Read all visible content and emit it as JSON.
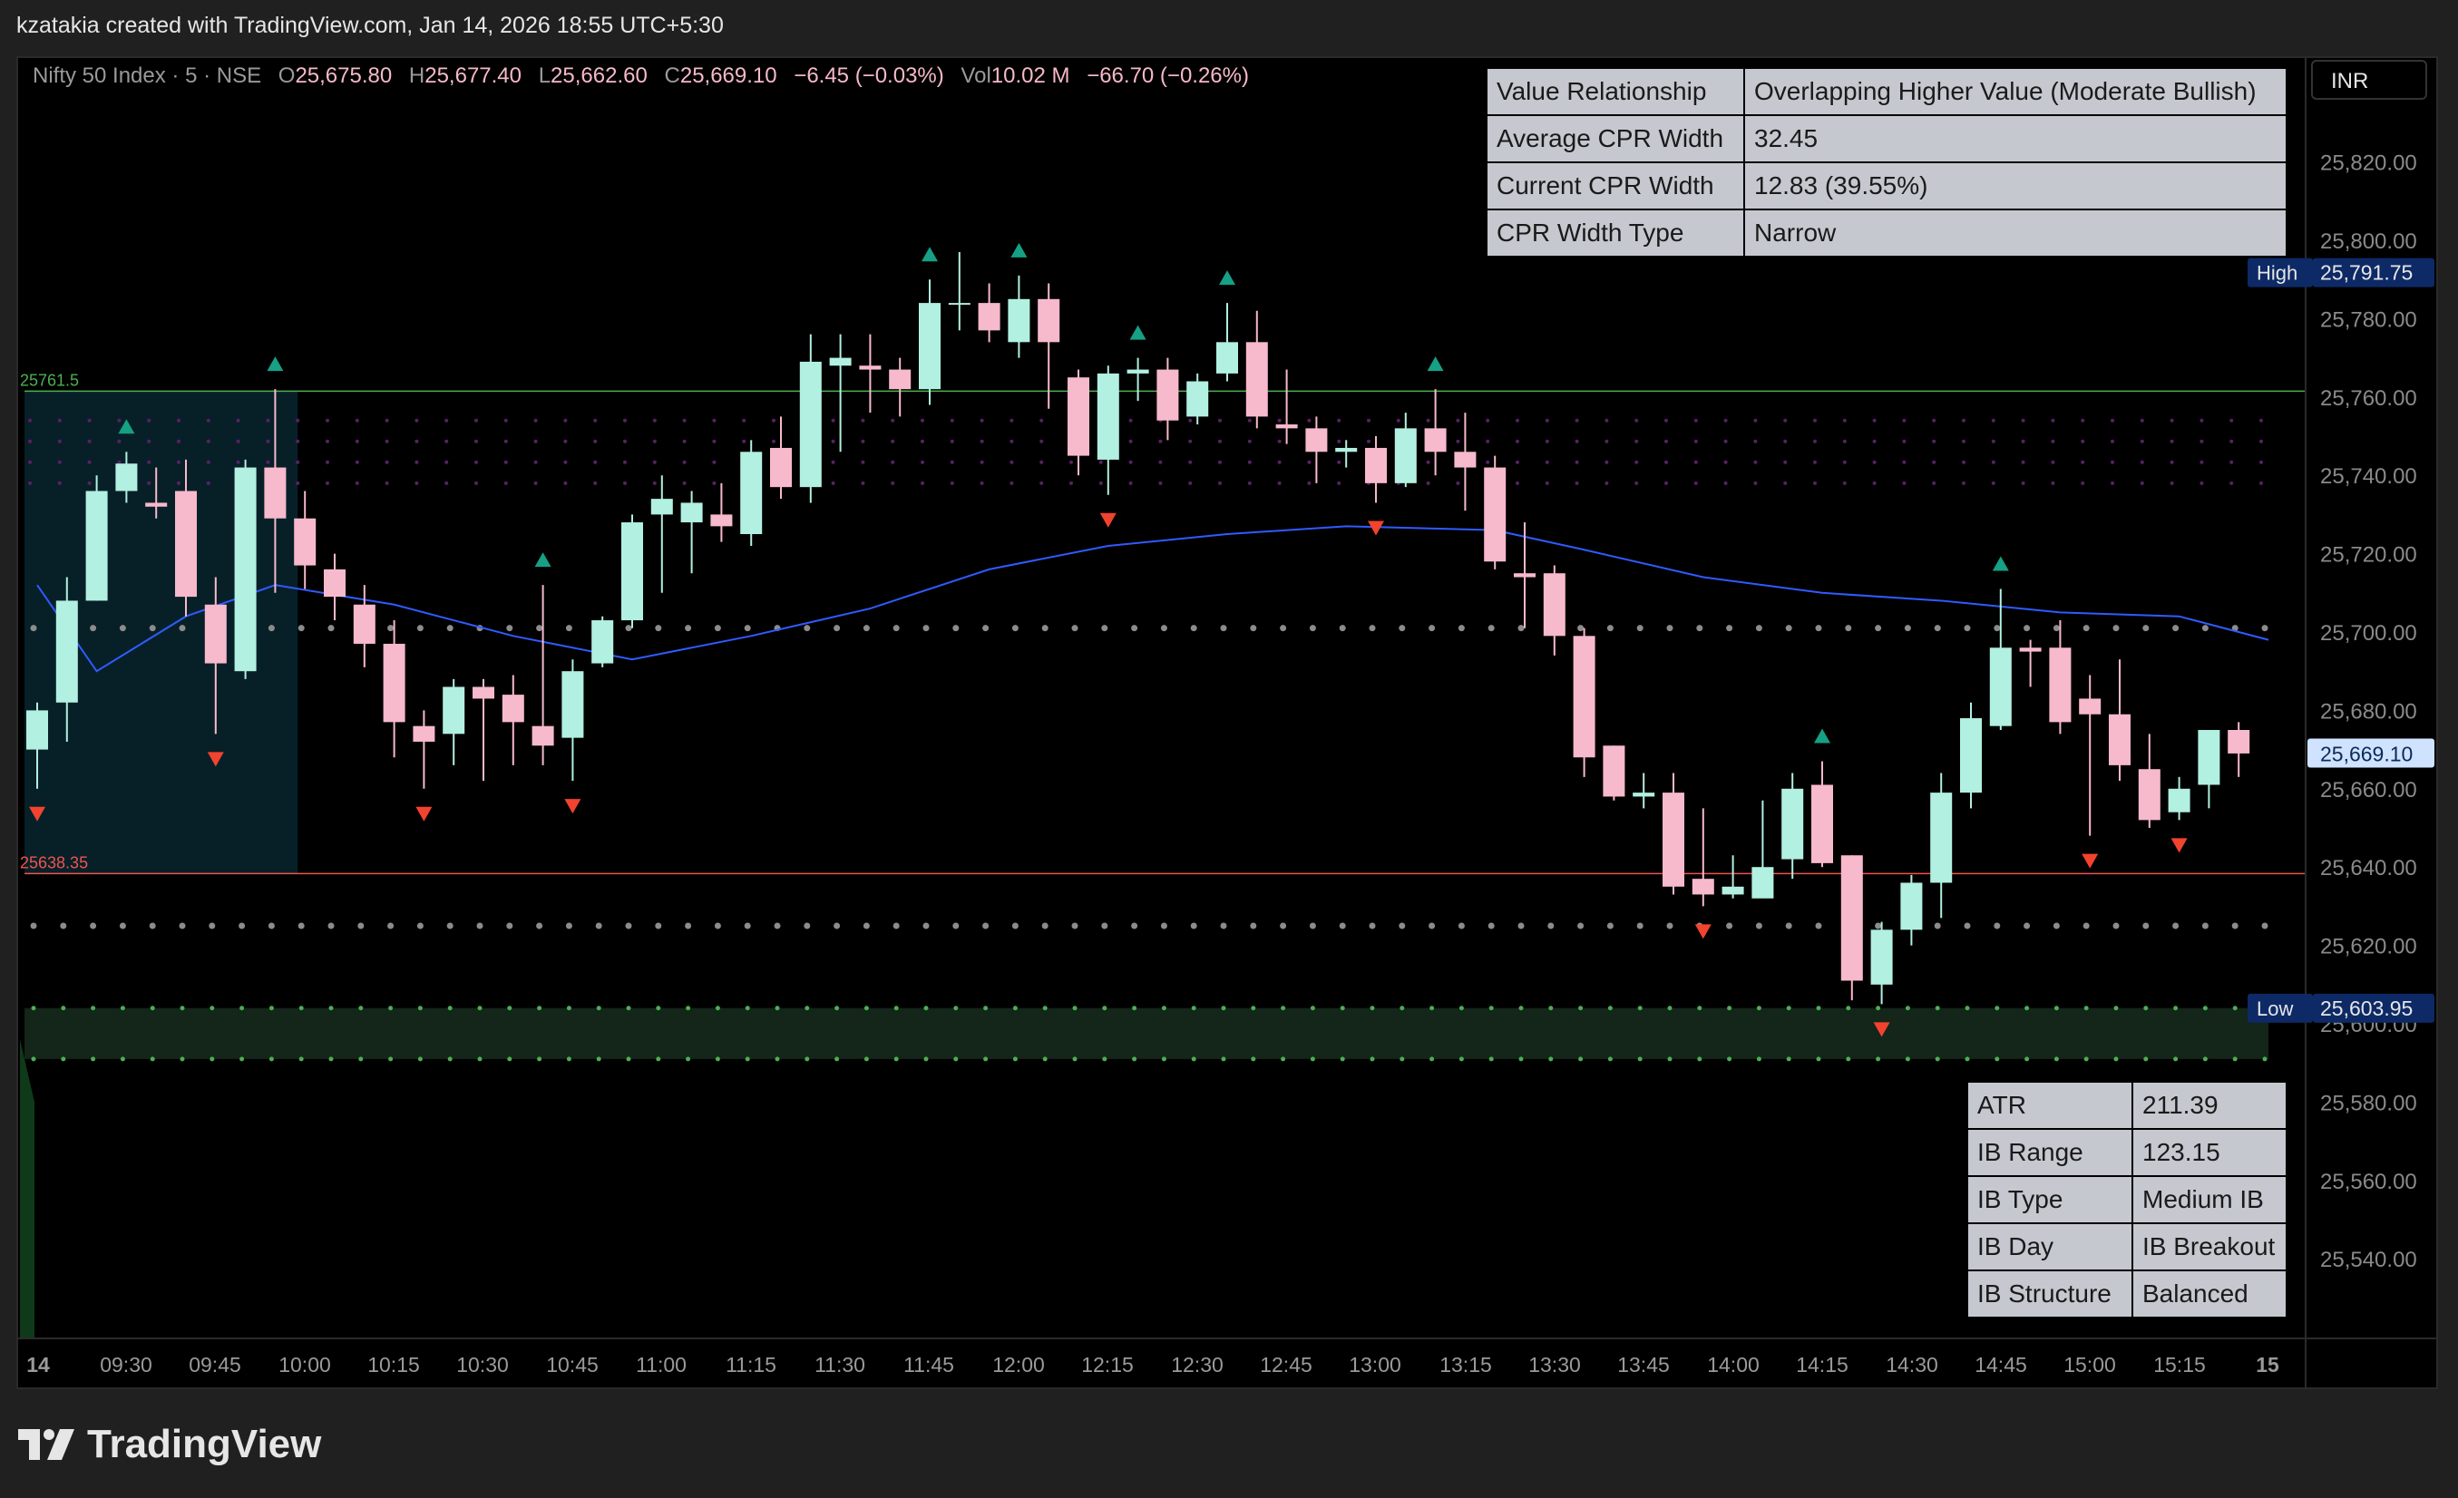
{
  "header": {
    "attribution": "kzatakia created with TradingView.com, Jan 14, 2026 18:55 UTC+5:30"
  },
  "legend": {
    "symbol": "Nifty 50 Index · 5 · NSE",
    "o_label": "O",
    "o": "25,675.80",
    "h_label": "H",
    "h": "25,677.40",
    "l_label": "L",
    "l": "25,662.60",
    "c_label": "C",
    "c": "25,669.10",
    "change": "−6.45 (−0.03%)",
    "vol_label": "Vol",
    "vol": "10.02 M",
    "vol_change": "−66.70 (−0.26%)"
  },
  "currency": "INR",
  "cpr_table": [
    [
      "Value Relationship",
      "Overlapping Higher Value (Moderate Bullish)"
    ],
    [
      "Average CPR Width",
      "32.45"
    ],
    [
      "Current CPR Width",
      "12.83 (39.55%)"
    ],
    [
      "CPR Width Type",
      "Narrow"
    ]
  ],
  "ib_table": [
    [
      "ATR",
      "211.39"
    ],
    [
      "IB Range",
      "123.15"
    ],
    [
      "IB Type",
      "Medium IB"
    ],
    [
      "IB Day",
      "IB Breakout"
    ],
    [
      "IB Structure",
      "Balanced"
    ]
  ],
  "brand": "TradingView",
  "colors": {
    "up": "#b2f0e1",
    "down": "#f7b9cc",
    "ema": "#2f5bff",
    "high_line": "#4caf50",
    "low_line": "#ef5350",
    "signal_up": "#16a085",
    "signal_down": "#f2432f"
  },
  "chart_data": {
    "type": "candlestick",
    "ylim": [
      25520,
      25850
    ],
    "yticks": [
      25540,
      25560,
      25580,
      25600,
      25620,
      25640,
      25660,
      25680,
      25700,
      25720,
      25740,
      25760,
      25780,
      25800,
      25820
    ],
    "ytick_labels": [
      "25,540.00",
      "25,560.00",
      "25,580.00",
      "25,600.00",
      "25,620.00",
      "25,640.00",
      "25,660.00",
      "25,680.00",
      "25,700.00",
      "25,720.00",
      "25,740.00",
      "25,760.00",
      "25,780.00",
      "25,800.00",
      "25,820.00"
    ],
    "xticks": [
      "14",
      "09:30",
      "09:45",
      "10:00",
      "10:15",
      "10:30",
      "10:45",
      "11:00",
      "11:15",
      "11:30",
      "11:45",
      "12:00",
      "12:15",
      "12:30",
      "12:45",
      "13:00",
      "13:15",
      "13:30",
      "13:45",
      "14:00",
      "14:15",
      "14:30",
      "14:45",
      "15:00",
      "15:15",
      "15"
    ],
    "bar_count": 76,
    "candles": [
      [
        25670,
        25680,
        25660,
        25682
      ],
      [
        25682,
        25708,
        25672,
        25714
      ],
      [
        25708,
        25736,
        25708,
        25740
      ],
      [
        25736,
        25743,
        25733,
        25746
      ],
      [
        25733,
        25732,
        25729,
        25742
      ],
      [
        25736,
        25709,
        25704,
        25744
      ],
      [
        25707,
        25692,
        25674,
        25714
      ],
      [
        25690,
        25742,
        25688,
        25744
      ],
      [
        25742,
        25729,
        25710,
        25762
      ],
      [
        25729,
        25717,
        25711,
        25736
      ],
      [
        25716,
        25709,
        25703,
        25720
      ],
      [
        25707,
        25697,
        25691,
        25712
      ],
      [
        25697,
        25677,
        25668,
        25703
      ],
      [
        25676,
        25672,
        25660,
        25680
      ],
      [
        25674,
        25686,
        25666,
        25688
      ],
      [
        25686,
        25683,
        25662,
        25688
      ],
      [
        25684,
        25677,
        25666,
        25689
      ],
      [
        25676,
        25671,
        25666,
        25712
      ],
      [
        25673,
        25690,
        25662,
        25693
      ],
      [
        25692,
        25703,
        25691,
        25704
      ],
      [
        25703,
        25728,
        25701,
        25730
      ],
      [
        25730,
        25734,
        25710,
        25740
      ],
      [
        25728,
        25733,
        25715,
        25736
      ],
      [
        25730,
        25727,
        25723,
        25738
      ],
      [
        25725,
        25746,
        25722,
        25749
      ],
      [
        25747,
        25737,
        25734,
        25755
      ],
      [
        25737,
        25769,
        25733,
        25776
      ],
      [
        25768,
        25770,
        25746,
        25776
      ],
      [
        25768,
        25767,
        25756,
        25776
      ],
      [
        25767,
        25762,
        25755,
        25770
      ],
      [
        25762,
        25784,
        25758,
        25790
      ],
      [
        25784,
        25784,
        25777,
        25797
      ],
      [
        25784,
        25777,
        25774,
        25789
      ],
      [
        25774,
        25785,
        25770,
        25791
      ],
      [
        25785,
        25774,
        25757,
        25789
      ],
      [
        25765,
        25745,
        25740,
        25767
      ],
      [
        25744,
        25766,
        25735,
        25768
      ],
      [
        25766,
        25767,
        25759,
        25770
      ],
      [
        25767,
        25754,
        25749,
        25770
      ],
      [
        25755,
        25764,
        25753,
        25766
      ],
      [
        25766,
        25774,
        25764,
        25784
      ],
      [
        25774,
        25755,
        25752,
        25782
      ],
      [
        25753,
        25752,
        25748,
        25767
      ],
      [
        25752,
        25746,
        25738,
        25755
      ],
      [
        25746,
        25747,
        25742,
        25749
      ],
      [
        25747,
        25738,
        25733,
        25750
      ],
      [
        25738,
        25752,
        25737,
        25756
      ],
      [
        25752,
        25746,
        25740,
        25762
      ],
      [
        25746,
        25742,
        25731,
        25756
      ],
      [
        25742,
        25718,
        25716,
        25745
      ],
      [
        25715,
        25714,
        25701,
        25728
      ],
      [
        25715,
        25699,
        25694,
        25717
      ],
      [
        25699,
        25668,
        25663,
        25701
      ],
      [
        25671,
        25658,
        25657,
        25671
      ],
      [
        25658,
        25659,
        25655,
        25664
      ],
      [
        25659,
        25635,
        25633,
        25664
      ],
      [
        25637,
        25633,
        25630,
        25655
      ],
      [
        25633,
        25635,
        25632,
        25643
      ],
      [
        25632,
        25640,
        25633,
        25657
      ],
      [
        25642,
        25660,
        25637,
        25664
      ],
      [
        25661,
        25641,
        25640,
        25667
      ],
      [
        25643,
        25611,
        25606,
        25643
      ],
      [
        25610,
        25624,
        25605,
        25626
      ],
      [
        25624,
        25636,
        25620,
        25638
      ],
      [
        25636,
        25659,
        25627,
        25664
      ],
      [
        25659,
        25678,
        25655,
        25682
      ],
      [
        25676,
        25696,
        25675,
        25711
      ],
      [
        25696,
        25695,
        25686,
        25698
      ],
      [
        25696,
        25677,
        25674,
        25703
      ],
      [
        25683,
        25679,
        25648,
        25689
      ],
      [
        25679,
        25666,
        25662,
        25693
      ],
      [
        25665,
        25652,
        25650,
        25674
      ],
      [
        25654,
        25660,
        25652,
        25663
      ],
      [
        25661,
        25675,
        25655,
        25675
      ],
      [
        25675,
        25669,
        25663,
        25677
      ]
    ],
    "ema": [
      [
        0,
        25712
      ],
      [
        2,
        25690
      ],
      [
        5,
        25704
      ],
      [
        8,
        25712
      ],
      [
        12,
        25707
      ],
      [
        16,
        25699
      ],
      [
        20,
        25693
      ],
      [
        24,
        25699
      ],
      [
        28,
        25706
      ],
      [
        32,
        25716
      ],
      [
        36,
        25722
      ],
      [
        40,
        25725
      ],
      [
        44,
        25727
      ],
      [
        49,
        25726
      ],
      [
        52,
        25721
      ],
      [
        56,
        25714
      ],
      [
        60,
        25710
      ],
      [
        64,
        25708
      ],
      [
        68,
        25705
      ],
      [
        72,
        25704
      ],
      [
        75,
        25698
      ]
    ],
    "levels": {
      "initial_balance_high": 25761.5,
      "initial_balance_low": 25638.35,
      "ib_high_label": "25761.5",
      "ib_low_label": "25638.35",
      "cpr_dots": [
        25701,
        25625
      ],
      "green_band": [
        25591,
        25604
      ],
      "purple_zone": [
        25738,
        25754
      ]
    },
    "price_labels": [
      {
        "name": "High",
        "value": 25791.75,
        "text": "25,791.75"
      },
      {
        "name": "Low",
        "value": 25603.95,
        "text": "25,603.95"
      },
      {
        "name": "Last",
        "value": 25669.1,
        "text": "25,669.10"
      }
    ],
    "signals_up": [
      3,
      8,
      17,
      30,
      33,
      37,
      40,
      47,
      60,
      66
    ],
    "signals_down": [
      0,
      6,
      13,
      18,
      36,
      45,
      56,
      62,
      69,
      72
    ]
  }
}
